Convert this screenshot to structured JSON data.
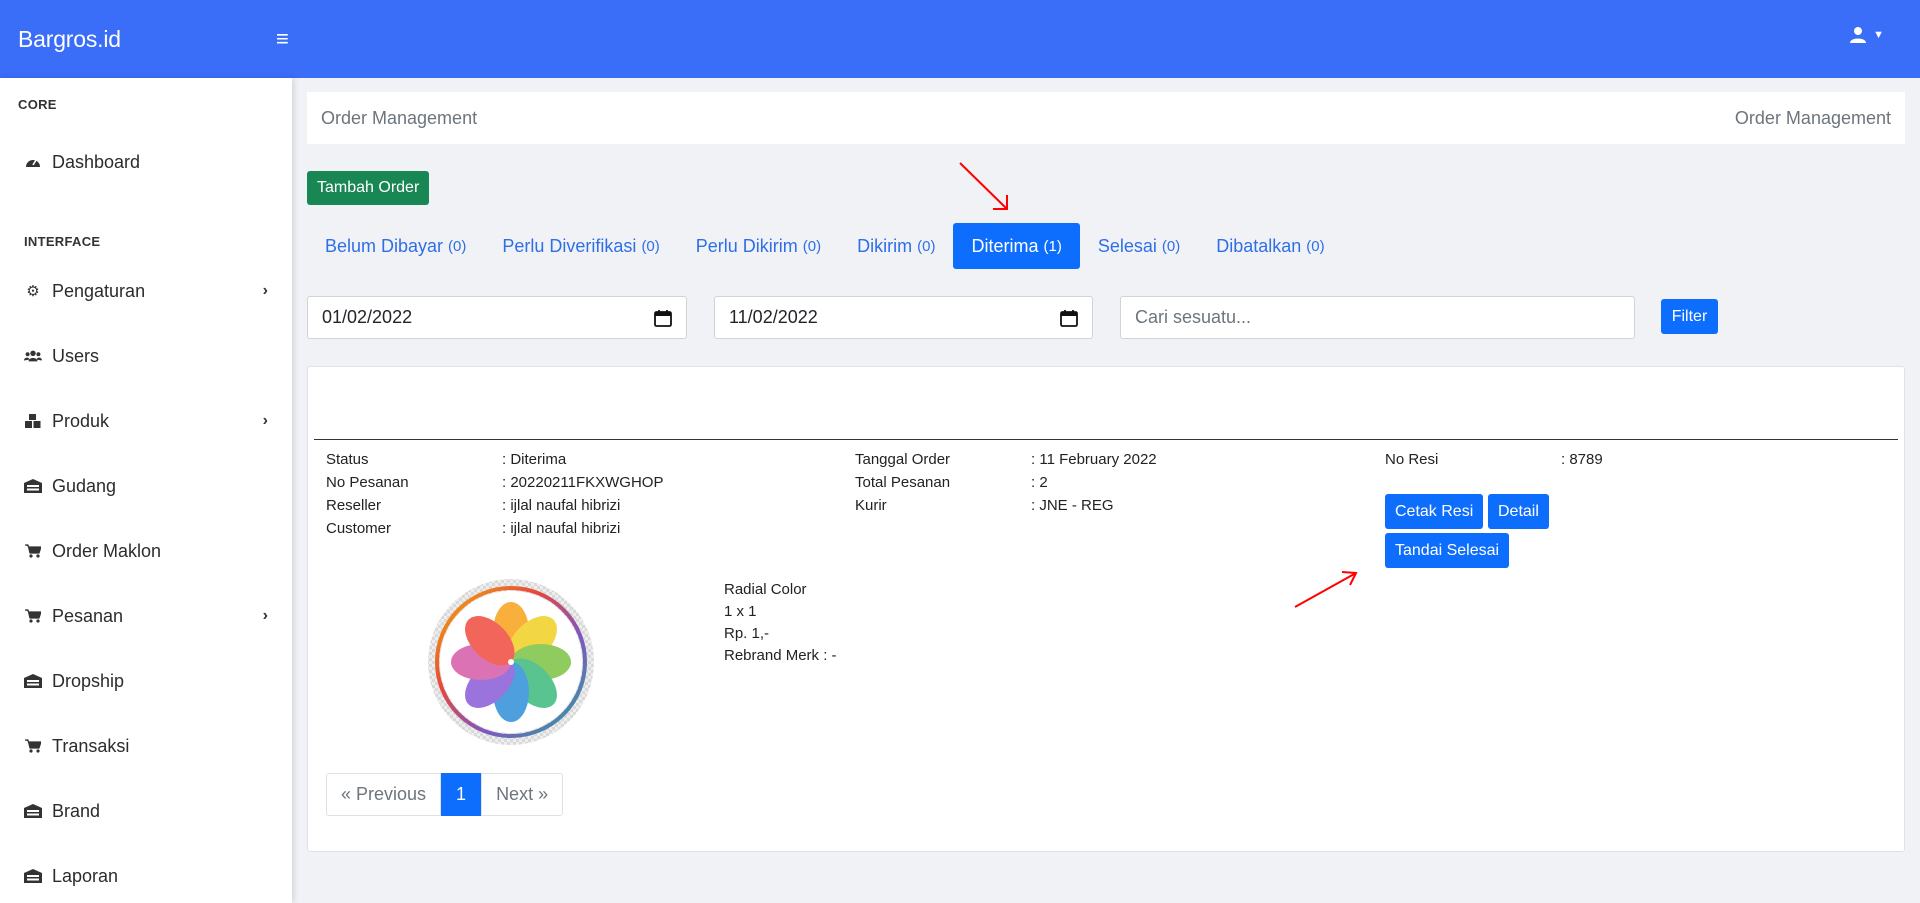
{
  "header": {
    "brand": "Bargros.id",
    "menu_icon": "hamburger-icon",
    "user_icon": "user-icon"
  },
  "sidebar": {
    "sections": [
      {
        "title": "CORE"
      },
      {
        "title": "INTERFACE"
      }
    ],
    "items": [
      {
        "label": "Dashboard",
        "icon": "gauge-icon",
        "has_children": false
      },
      {
        "label": "Pengaturan",
        "icon": "gear-icon",
        "has_children": true
      },
      {
        "label": "Users",
        "icon": "users-icon",
        "has_children": false
      },
      {
        "label": "Produk",
        "icon": "boxes-icon",
        "has_children": true
      },
      {
        "label": "Gudang",
        "icon": "warehouse-icon",
        "has_children": false
      },
      {
        "label": "Order Maklon",
        "icon": "cart-icon",
        "has_children": false
      },
      {
        "label": "Pesanan",
        "icon": "cart-icon",
        "has_children": true
      },
      {
        "label": "Dropship",
        "icon": "warehouse-icon",
        "has_children": false
      },
      {
        "label": "Transaksi",
        "icon": "cart-icon",
        "has_children": false
      },
      {
        "label": "Brand",
        "icon": "warehouse-icon",
        "has_children": false
      },
      {
        "label": "Laporan",
        "icon": "warehouse-icon",
        "has_children": false
      }
    ]
  },
  "breadcrumb": {
    "left": "Order Management",
    "right": "Order Management"
  },
  "actions": {
    "add_order": "Tambah Order"
  },
  "tabs": [
    {
      "label": "Belum Dibayar",
      "count": "(0)",
      "active": false
    },
    {
      "label": "Perlu Diverifikasi",
      "count": "(0)",
      "active": false
    },
    {
      "label": "Perlu Dikirim",
      "count": "(0)",
      "active": false
    },
    {
      "label": "Dikirim",
      "count": "(0)",
      "active": false
    },
    {
      "label": "Diterima",
      "count": "(1)",
      "active": true
    },
    {
      "label": "Selesai",
      "count": "(0)",
      "active": false
    },
    {
      "label": "Dibatalkan",
      "count": "(0)",
      "active": false
    }
  ],
  "filters": {
    "date_from": "01/02/2022",
    "date_to": "11/02/2022",
    "search_placeholder": "Cari sesuatu...",
    "filter_label": "Filter"
  },
  "order": {
    "left": [
      {
        "key": "Status",
        "value": ": Diterima"
      },
      {
        "key": "No Pesanan",
        "value": ": 20220211FKXWGHOP"
      },
      {
        "key": "Reseller",
        "value": ": ijlal naufal hibrizi"
      },
      {
        "key": "Customer",
        "value": ": ijlal naufal hibrizi"
      }
    ],
    "middle": [
      {
        "key": "Tanggal Order",
        "value": ": 11 February 2022"
      },
      {
        "key": "Total Pesanan",
        "value": ": 2"
      },
      {
        "key": "Kurir",
        "value": ": JNE - REG"
      }
    ],
    "right": [
      {
        "key": "No Resi",
        "value": ": 8789"
      }
    ],
    "buttons": {
      "print_receipt": "Cetak Resi",
      "detail": "Detail",
      "mark_done": "Tandai Selesai"
    },
    "product": {
      "name": "Radial Color",
      "qty": "1 x 1",
      "price": "Rp. 1,-",
      "rebrand": "Rebrand Merk : -"
    }
  },
  "pagination": {
    "previous": "« Previous",
    "current": "1",
    "next": "Next »"
  },
  "colors": {
    "navbar": "#3a6df8",
    "primary": "#0d6efd",
    "success": "#198754",
    "annotation_arrow": "#ff0000"
  }
}
